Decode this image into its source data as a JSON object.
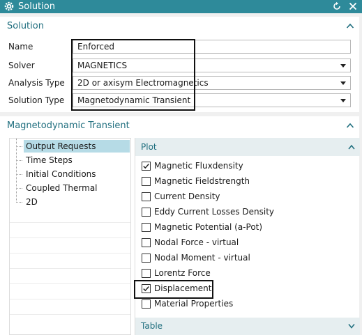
{
  "window": {
    "title": "Solution"
  },
  "solution_section": {
    "header": "Solution",
    "name_label": "Name",
    "name_value": "Enforced",
    "solver_label": "Solver",
    "solver_value": "MAGNETICS",
    "analysis_type_label": "Analysis Type",
    "analysis_type_value": "2D or axisym Electromagnetics",
    "solution_type_label": "Solution Type",
    "solution_type_value": "Magnetodynamic Transient"
  },
  "transient_section": {
    "header": "Magnetodynamic Transient",
    "tree": [
      {
        "label": "Output Requests",
        "selected": true
      },
      {
        "label": "Time Steps",
        "selected": false
      },
      {
        "label": "Initial Conditions",
        "selected": false
      },
      {
        "label": "Coupled Thermal",
        "selected": false
      },
      {
        "label": "2D",
        "selected": false
      }
    ],
    "plot_header": "Plot",
    "plot_items": [
      {
        "label": "Magnetic Fluxdensity",
        "checked": true
      },
      {
        "label": "Magnetic Fieldstrength",
        "checked": false
      },
      {
        "label": "Current Density",
        "checked": false
      },
      {
        "label": "Eddy Current Losses Density",
        "checked": false
      },
      {
        "label": "Magnetic Potential (a-Pot)",
        "checked": false
      },
      {
        "label": "Nodal Force - virtual",
        "checked": false
      },
      {
        "label": "Nodal Moment - virtual",
        "checked": false
      },
      {
        "label": "Lorentz Force",
        "checked": false
      },
      {
        "label": "Displacement",
        "checked": true
      },
      {
        "label": "Material Properties",
        "checked": false
      }
    ],
    "table_header": "Table"
  },
  "colors": {
    "titlebar": "#2e8a9a",
    "section_header_text": "#1f6e7e",
    "tree_selection": "#b6dbe6"
  },
  "icons": [
    "gear-icon",
    "reset-icon",
    "close-icon",
    "chevron-up-icon",
    "chevron-down-icon",
    "dropdown-arrow-icon",
    "checkmark-icon"
  ]
}
